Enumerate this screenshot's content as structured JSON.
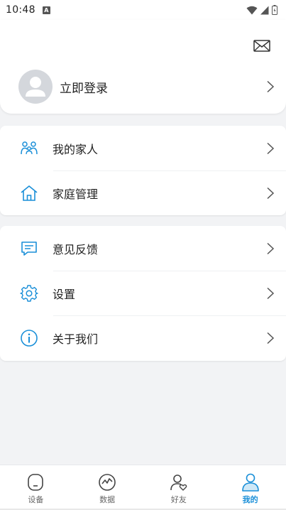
{
  "status_bar": {
    "time": "10:48",
    "notification_badge": "A"
  },
  "header": {
    "login_label": "立即登录"
  },
  "menu_group_1": [
    {
      "label": "我的家人",
      "icon": "family-icon"
    },
    {
      "label": "家庭管理",
      "icon": "home-icon"
    }
  ],
  "menu_group_2": [
    {
      "label": "意见反馈",
      "icon": "feedback-icon"
    },
    {
      "label": "设置",
      "icon": "settings-icon"
    },
    {
      "label": "关于我们",
      "icon": "info-icon"
    }
  ],
  "tabs": [
    {
      "label": "设备",
      "icon": "device-icon",
      "active": false
    },
    {
      "label": "数据",
      "icon": "chart-icon",
      "active": false
    },
    {
      "label": "好友",
      "icon": "friend-icon",
      "active": false
    },
    {
      "label": "我的",
      "icon": "profile-icon",
      "active": true
    }
  ],
  "colors": {
    "accent": "#1a8fd8",
    "background": "#f2f3f5",
    "text": "#222222",
    "muted": "#666666"
  }
}
